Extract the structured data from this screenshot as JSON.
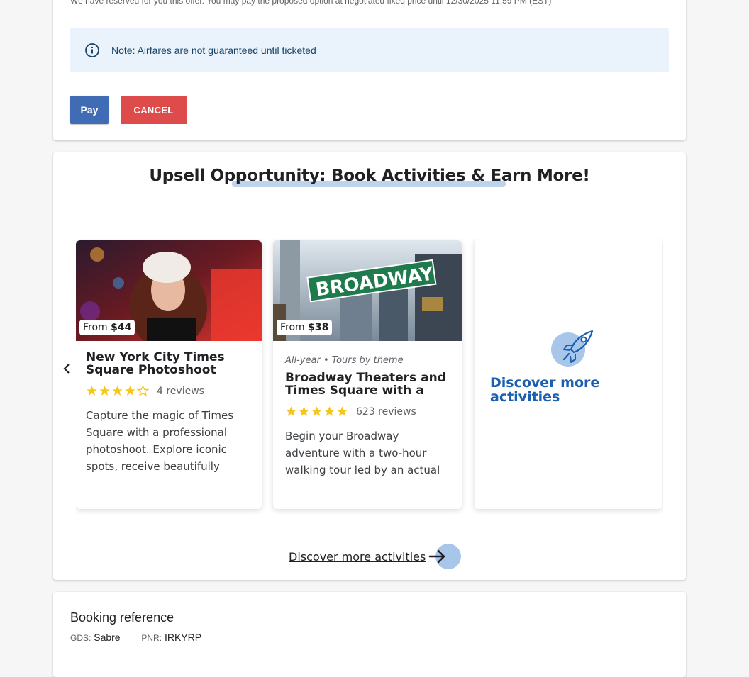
{
  "offer": {
    "reserved_text": "We have reserved for you this offer. You may pay the proposed option at negotiated fixed price until 12/30/2025 11:59 PM (EST)",
    "note": "Note: Airfares are not guaranteed until ticketed",
    "pay_label": "Pay",
    "cancel_label": "CANCEL"
  },
  "upsell": {
    "title": "Upsell Opportunity: Book Activities & Earn More!",
    "prev_icon": "chevron-left-icon",
    "activities": [
      {
        "price_prefix": "From",
        "price": "$44",
        "title": "New York City Times Square Photoshoot",
        "rating": 4,
        "reviews": "4 reviews",
        "description": "Capture the magic of Times Square with a professional photoshoot. Explore iconic spots, receive beautifully edited photos."
      },
      {
        "price_prefix": "From",
        "price": "$38",
        "meta": "All-year • Tours by theme",
        "title": "Broadway Theaters and Times Square with a Broadway Insider",
        "rating": 5,
        "reviews": "623 reviews",
        "description": "Begin your Broadway adventure with a two-hour walking tour led by an actual Broadway insider."
      }
    ],
    "sign_text": "BROADWAY",
    "discover_card_text": "Discover more activities",
    "discover_link_text": "Discover more activities"
  },
  "booking": {
    "title": "Booking reference",
    "gds_label": "GDS:",
    "gds_value": "Sabre",
    "pnr_label": "PNR:",
    "pnr_value": "IRKYRP"
  },
  "colors": {
    "pay": "#3f6cb5",
    "cancel": "#dd4b4b",
    "note_bg": "#eaf3fb",
    "link_blue": "#1a5fb0",
    "star": "#f5c518",
    "accent_light": "#a7c6ea"
  }
}
